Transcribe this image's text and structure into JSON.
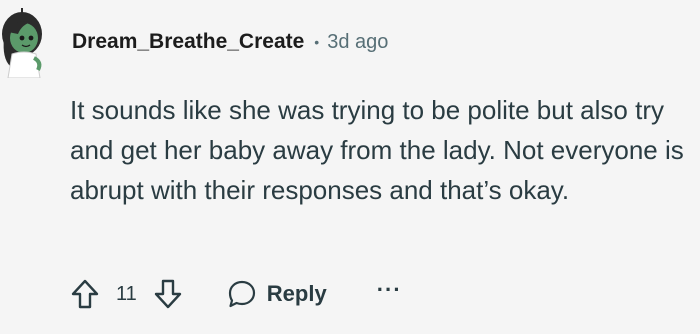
{
  "comment": {
    "author": "Dream_Breathe_Create",
    "separator": "•",
    "timestamp": "3d ago",
    "body": "It sounds like she was trying to be polite but also try and get her baby away from the lady. Not everyone is abrupt with their responses and that’s okay."
  },
  "actions": {
    "upvote_icon": "arrow-up-icon",
    "vote_count": "11",
    "downvote_icon": "arrow-down-icon",
    "reply_icon": "speech-bubble-icon",
    "reply_label": "Reply",
    "more_label": "···"
  },
  "avatar": {
    "icon": "alien-avatar-icon",
    "skin_color": "#5b9a6a",
    "hair_color": "#2b2b2b"
  }
}
